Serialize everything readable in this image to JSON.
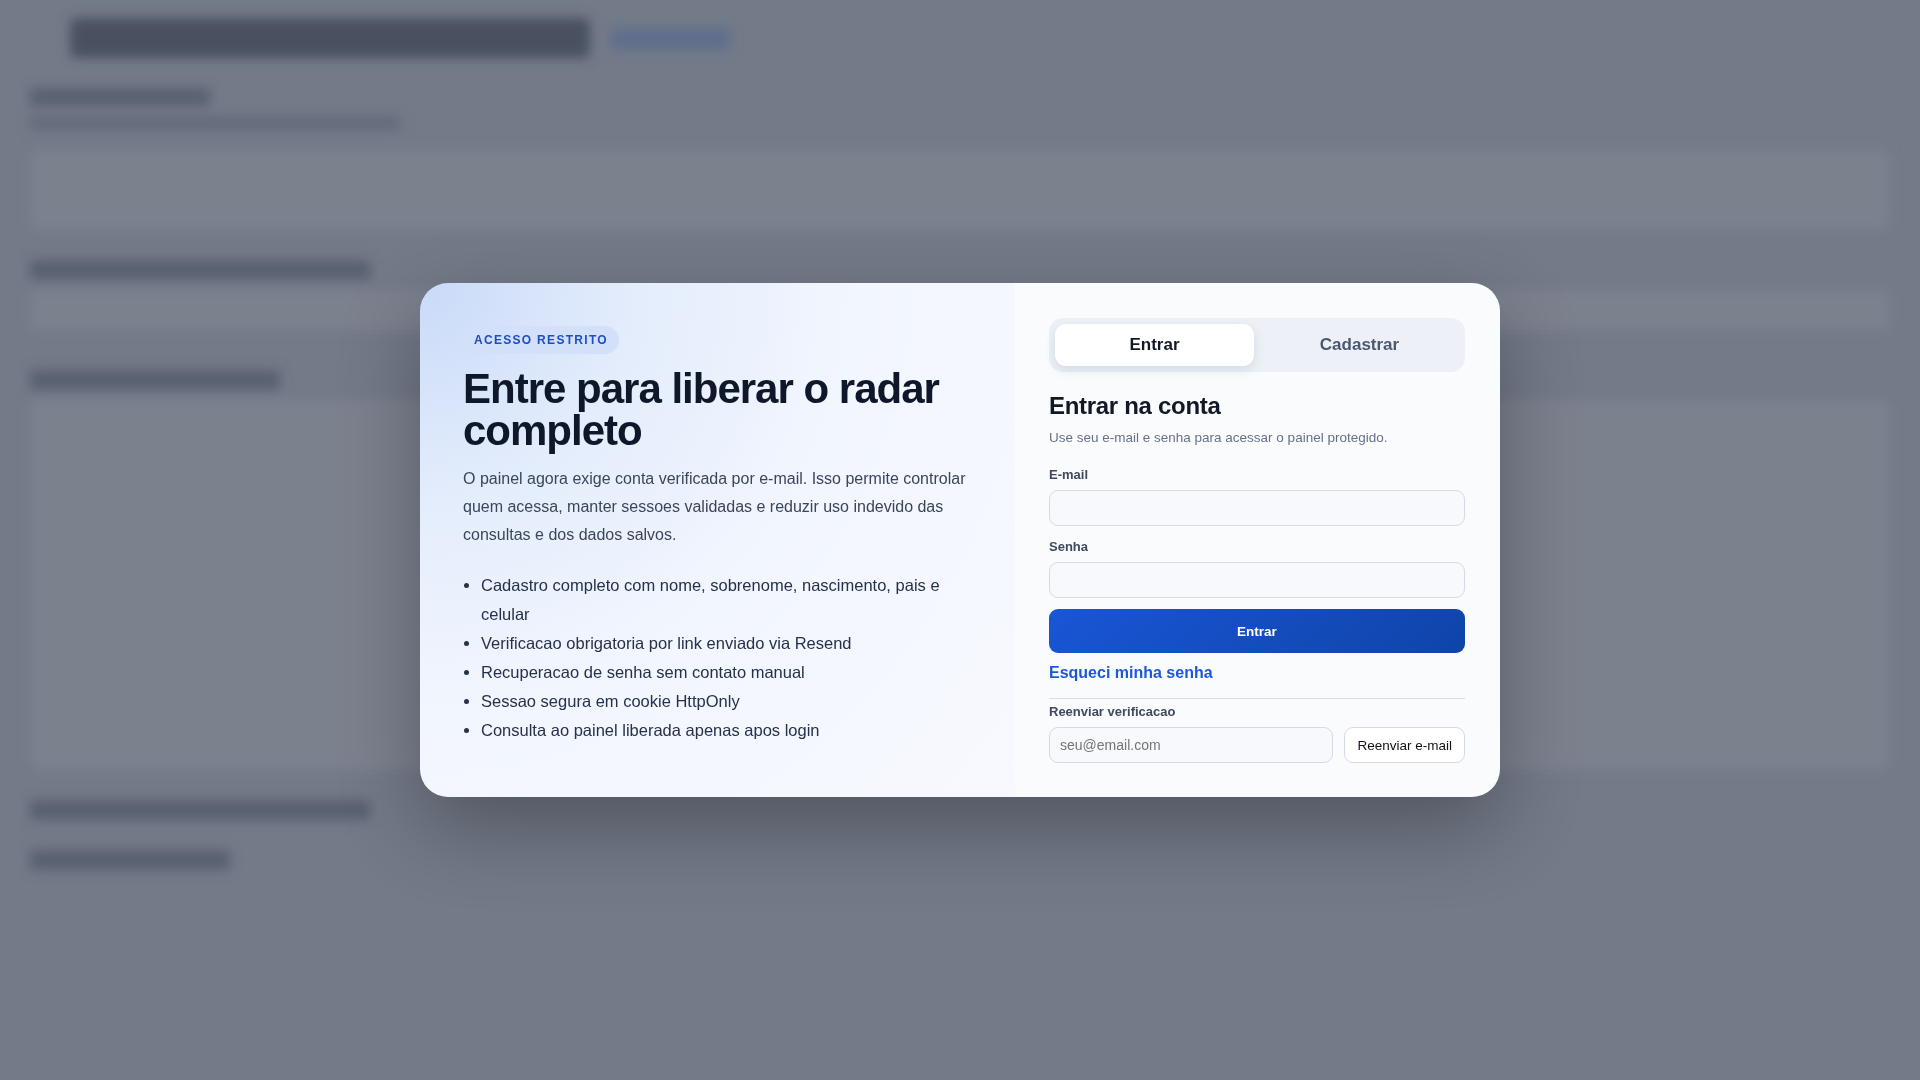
{
  "modal": {
    "intro": {
      "badge": "ACESSO RESTRITO",
      "title": "Entre para liberar o radar completo",
      "description": "O painel agora exige conta verificada por e-mail. Isso permite controlar quem acessa, manter sessoes validadas e reduzir uso indevido das consultas e dos dados salvos.",
      "features": [
        "Cadastro completo com nome, sobrenome, nascimento, pais e celular",
        "Verificacao obrigatoria por link enviado via Resend",
        "Recuperacao de senha sem contato manual",
        "Sessao segura em cookie HttpOnly",
        "Consulta ao painel liberada apenas apos login"
      ]
    },
    "auth": {
      "tabs": [
        {
          "label": "Entrar",
          "selected": true
        },
        {
          "label": "Cadastrar",
          "selected": false
        }
      ],
      "title": "Entrar na conta",
      "subtitle": "Use seu e-mail e senha para acessar o painel protegido.",
      "fields": [
        {
          "label": "E-mail"
        },
        {
          "label": "Senha"
        }
      ],
      "submit": "Entrar",
      "forgot_link": "Esqueci minha senha",
      "resend": {
        "label": "Reenviar verificacao",
        "placeholder": "seu@email.com",
        "button": "Reenviar e-mail"
      }
    }
  }
}
